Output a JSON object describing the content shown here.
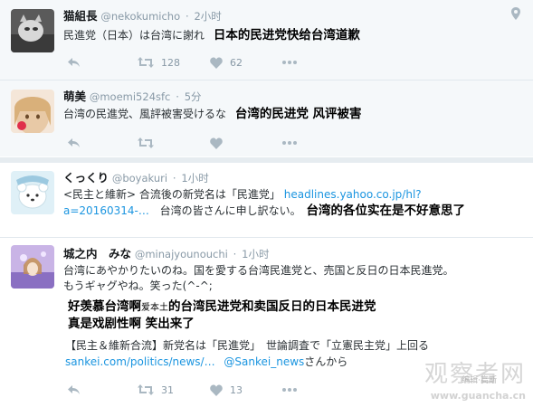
{
  "tweets": [
    {
      "name": "猫組長",
      "handle": "@nekokumicho",
      "dot": "·",
      "time": "2小时",
      "text": "民進党（日本）は台湾に謝れ",
      "overlay": "日本的民进党快给台湾道歉",
      "retweets": "128",
      "likes": "62"
    },
    {
      "name": "萌美",
      "handle": "@moemi524sfc",
      "dot": "·",
      "time": "5分",
      "text": "台湾の民進党、風評被害受けるな",
      "overlay": "台湾的民进党 风评被害",
      "retweets": "",
      "likes": ""
    },
    {
      "name": "くっくり",
      "handle": "@boyakuri",
      "dot": "·",
      "time": "1小时",
      "text_line1_a": "<民主と維新> 合流後の新党名は「民進党」",
      "text_line1_link": "headlines.yahoo.co.jp/hl?",
      "text_line2_link": "a=20160314-…",
      "text_line2_b": "台湾の皆さんに申し訳ない。",
      "overlay": "台湾的各位实在是不好意思了",
      "retweets": "",
      "likes": ""
    },
    {
      "name": "城之内　みな",
      "handle": "@minajyounouchi",
      "dot": "·",
      "time": "1小时",
      "text_line1": "台湾にあやかりたいのね。国を愛する台湾民進党と、売国と反日の日本民進党。",
      "text_line2": "もうギャグやね。笑った(^-^;",
      "overlay_line1_a": "好羡慕台湾啊",
      "overlay_line1_small": "爱本土",
      "overlay_line1_b": "的台湾民进党和卖国反日的日本民进党",
      "overlay_line2": "真是戏剧性啊 笑出来了",
      "quote_line": "【民主＆維新合流】新党名は「民進党」　世論調査で「立憲民主党」上回る",
      "quote_link": "sankei.com/politics/news/…",
      "quote_mention": "@Sankei_news",
      "quote_suffix": "さんから",
      "retweets": "31",
      "likes": "13"
    }
  ],
  "watermark": {
    "brand": "观察者网",
    "url": "www.guancha.cn",
    "credit": "编辑·高斯"
  },
  "colors": {
    "accent": "#1b95e0",
    "muted": "#8899a6",
    "icon": "#aab8c2",
    "separator": "#e1e8ed"
  }
}
